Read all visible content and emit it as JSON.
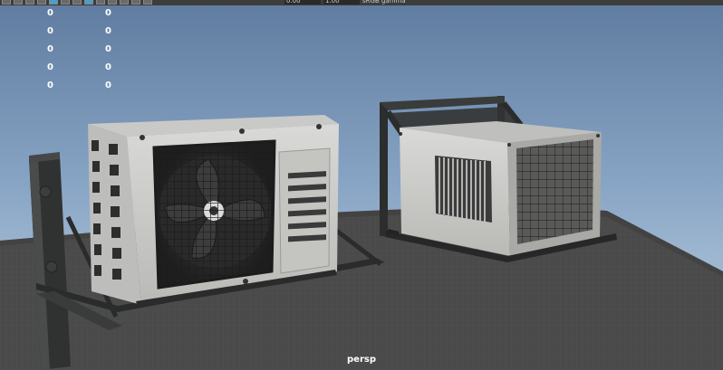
{
  "toolbar": {
    "field_1": "0.00",
    "field_2": "1.00",
    "color_space": "sRGB gamma",
    "icons": [
      "frame-icon",
      "grid-icon",
      "wireframe-icon",
      "camera-icon",
      "shaded-icon",
      "smooth-icon",
      "light-icon",
      "texture-icon",
      "shadow-icon",
      "isolate-icon",
      "xray-icon",
      "joint-icon",
      "gate-icon"
    ]
  },
  "hud": {
    "rows": [
      {
        "a": "0",
        "b": "0"
      },
      {
        "a": "0",
        "b": "0"
      },
      {
        "a": "0",
        "b": "0"
      },
      {
        "a": "0",
        "b": "0"
      },
      {
        "a": "0",
        "b": "0"
      }
    ]
  },
  "camera_label": "persp",
  "colors": {
    "sky_top": "#5f7ca0",
    "sky_bottom": "#9eb7d1",
    "ground": "#4a4a4a",
    "unit_body": "#cfcfcd",
    "metal_frame": "#2f3030"
  }
}
